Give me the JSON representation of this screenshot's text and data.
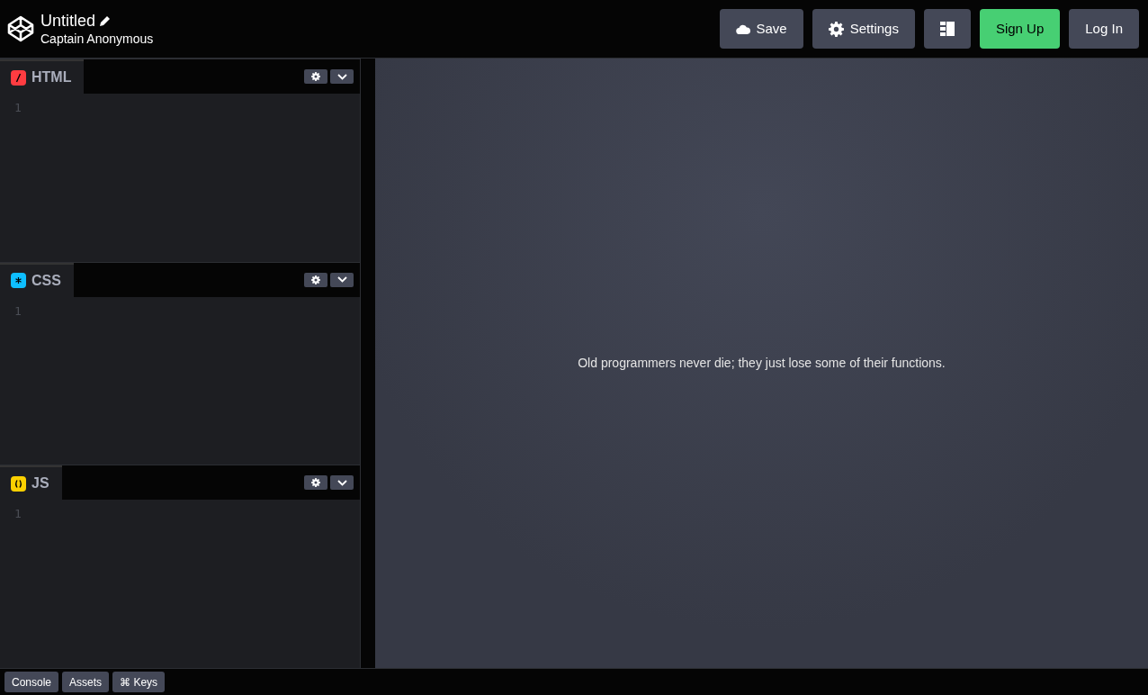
{
  "header": {
    "title": "Untitled",
    "author": "Captain Anonymous"
  },
  "buttons": [
    {
      "label": "Save",
      "kind": "save"
    },
    {
      "label": "Settings",
      "kind": "settings"
    },
    {
      "kind": "layout"
    },
    {
      "label": "Sign Up",
      "kind": "accent"
    },
    {
      "label": "Log In",
      "kind": "plain"
    }
  ],
  "editors": [
    {
      "label": "HTML",
      "kind": "html",
      "line_numbers": [
        "1"
      ]
    },
    {
      "label": "CSS",
      "kind": "css",
      "line_numbers": [
        "1"
      ]
    },
    {
      "label": "JS",
      "kind": "js",
      "line_numbers": [
        "1"
      ]
    }
  ],
  "preview": {
    "text": "Old programmers never die; they just lose some of their functions."
  },
  "footer": [
    "Console",
    "Assets",
    "⌘ Keys"
  ]
}
